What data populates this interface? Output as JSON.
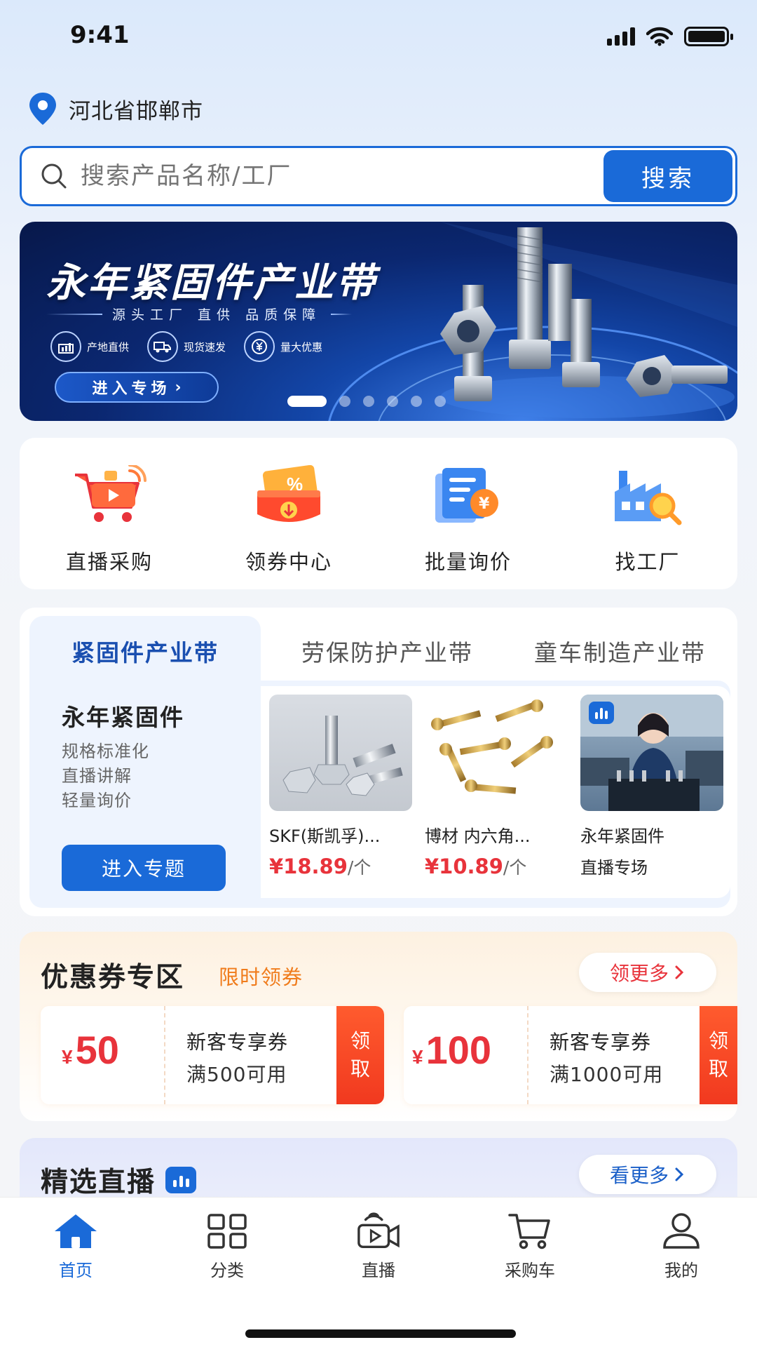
{
  "status_bar": {
    "time": "9:41"
  },
  "location": {
    "city": "河北省邯郸市"
  },
  "search": {
    "placeholder": "搜索产品名称/工厂",
    "button": "搜索"
  },
  "banner": {
    "title": "永年紧固件产业带",
    "subtitle": "源头工厂 直供 品质保障",
    "features": [
      "产地直供",
      "现货速发",
      "量大优惠"
    ],
    "cta": "进入专场",
    "dots": 6,
    "active_dot": 0
  },
  "quick_nav": [
    {
      "label": "直播采购",
      "icon": "live-cart-icon"
    },
    {
      "label": "领券中心",
      "icon": "coupon-icon"
    },
    {
      "label": "批量询价",
      "icon": "quote-icon"
    },
    {
      "label": "找工厂",
      "icon": "factory-search-icon"
    }
  ],
  "industry": {
    "tabs": [
      "紧固件产业带",
      "劳保防护产业带",
      "童车制造产业带"
    ],
    "active_tab": 0,
    "left": {
      "title": "永年紧固件",
      "features": [
        "规格标准化",
        "直播讲解",
        "轻量询价"
      ],
      "button": "进入专题"
    },
    "products": [
      {
        "name": "SKF(斯凯孚)...",
        "price": "¥18.89",
        "unit": "/个"
      },
      {
        "name": "博材 内六角...",
        "price": "¥10.89",
        "unit": "/个"
      },
      {
        "name": "永年紧固件",
        "sub": "直播专场"
      }
    ]
  },
  "coupons": {
    "title": "优惠券专区",
    "subtitle": "限时领券",
    "more": "领更多",
    "items": [
      {
        "currency": "¥",
        "amount": "50",
        "name": "新客专享券",
        "condition": "满500可用",
        "action_1": "领",
        "action_2": "取"
      },
      {
        "currency": "¥",
        "amount": "100",
        "name": "新客专享券",
        "condition": "满1000可用",
        "action_1": "领",
        "action_2": "取"
      }
    ]
  },
  "live": {
    "title": "精选直播",
    "more": "看更多"
  },
  "tabbar": [
    {
      "label": "首页",
      "icon": "home-icon",
      "active": true
    },
    {
      "label": "分类",
      "icon": "grid-icon",
      "active": false
    },
    {
      "label": "直播",
      "icon": "live-camera-icon",
      "active": false
    },
    {
      "label": "采购车",
      "icon": "cart-icon",
      "active": false
    },
    {
      "label": "我的",
      "icon": "user-icon",
      "active": false
    }
  ],
  "colors": {
    "primary": "#1a6ad8",
    "price": "#e8333b",
    "coupon_accent": "#f07c1c"
  }
}
